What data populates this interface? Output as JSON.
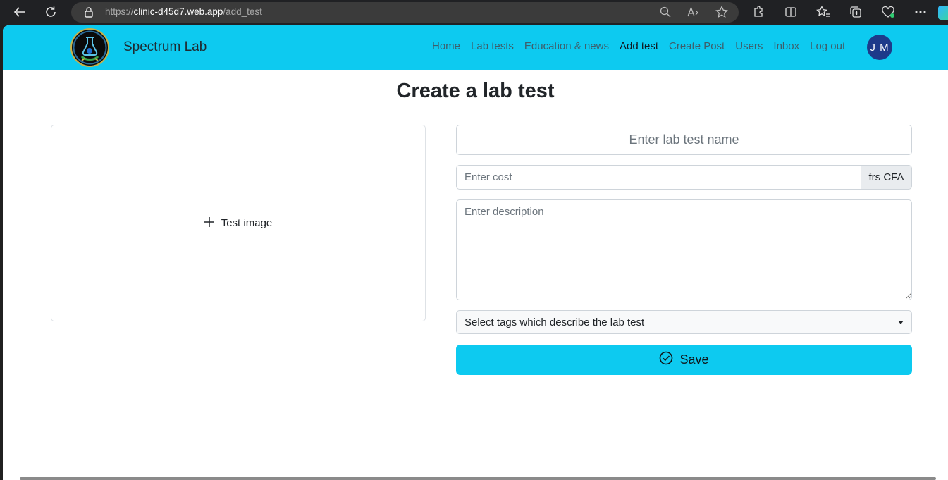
{
  "browser": {
    "url_prefix": "https://",
    "url_host": "clinic-d45d7.web.app",
    "url_path": "/add_test"
  },
  "navbar": {
    "brand": "Spectrum Lab",
    "links": [
      {
        "label": "Home",
        "active": false
      },
      {
        "label": "Lab tests",
        "active": false
      },
      {
        "label": "Education & news",
        "active": false
      },
      {
        "label": "Add test",
        "active": true
      },
      {
        "label": "Create Post",
        "active": false
      },
      {
        "label": "Users",
        "active": false
      },
      {
        "label": "Inbox",
        "active": false
      },
      {
        "label": "Log out",
        "active": false
      }
    ],
    "avatar_initials": "J M",
    "bg_color": "#0dcaf0"
  },
  "page": {
    "title": "Create a lab test"
  },
  "form": {
    "image_label": "Test image",
    "name_placeholder": "Enter lab test name",
    "cost_placeholder": "Enter cost",
    "cost_unit": "frs CFA",
    "description_placeholder": "Enter description",
    "tags_placeholder": "Select tags which describe the lab test",
    "save_label": "Save"
  },
  "colors": {
    "accent": "#0dcaf0",
    "avatar": "#1d3a8a"
  }
}
